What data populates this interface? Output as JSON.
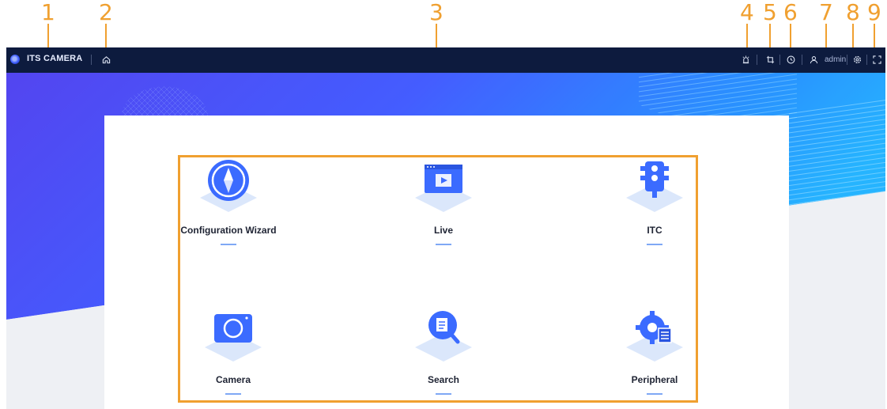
{
  "callouts": [
    "1",
    "2",
    "3",
    "4",
    "5",
    "6",
    "7",
    "8",
    "9"
  ],
  "topbar": {
    "brand": "ITS CAMERA",
    "username": "admin",
    "icons": [
      "home-icon",
      "alarm-icon",
      "crop-icon",
      "clock-icon",
      "user-icon",
      "settings-icon",
      "fullscreen-icon"
    ]
  },
  "tiles": [
    {
      "label": "Configuration Wizard",
      "icon": "compass-icon"
    },
    {
      "label": "Live",
      "icon": "video-player-icon"
    },
    {
      "label": "ITC",
      "icon": "traffic-light-icon"
    },
    {
      "label": "Camera",
      "icon": "camera-icon"
    },
    {
      "label": "Search",
      "icon": "search-document-icon"
    },
    {
      "label": "Peripheral",
      "icon": "gear-document-icon"
    }
  ],
  "colors": {
    "topbar": "#0d1b3e",
    "accent_blue": "#3b6bff",
    "annotation_orange": "#f0a030"
  }
}
